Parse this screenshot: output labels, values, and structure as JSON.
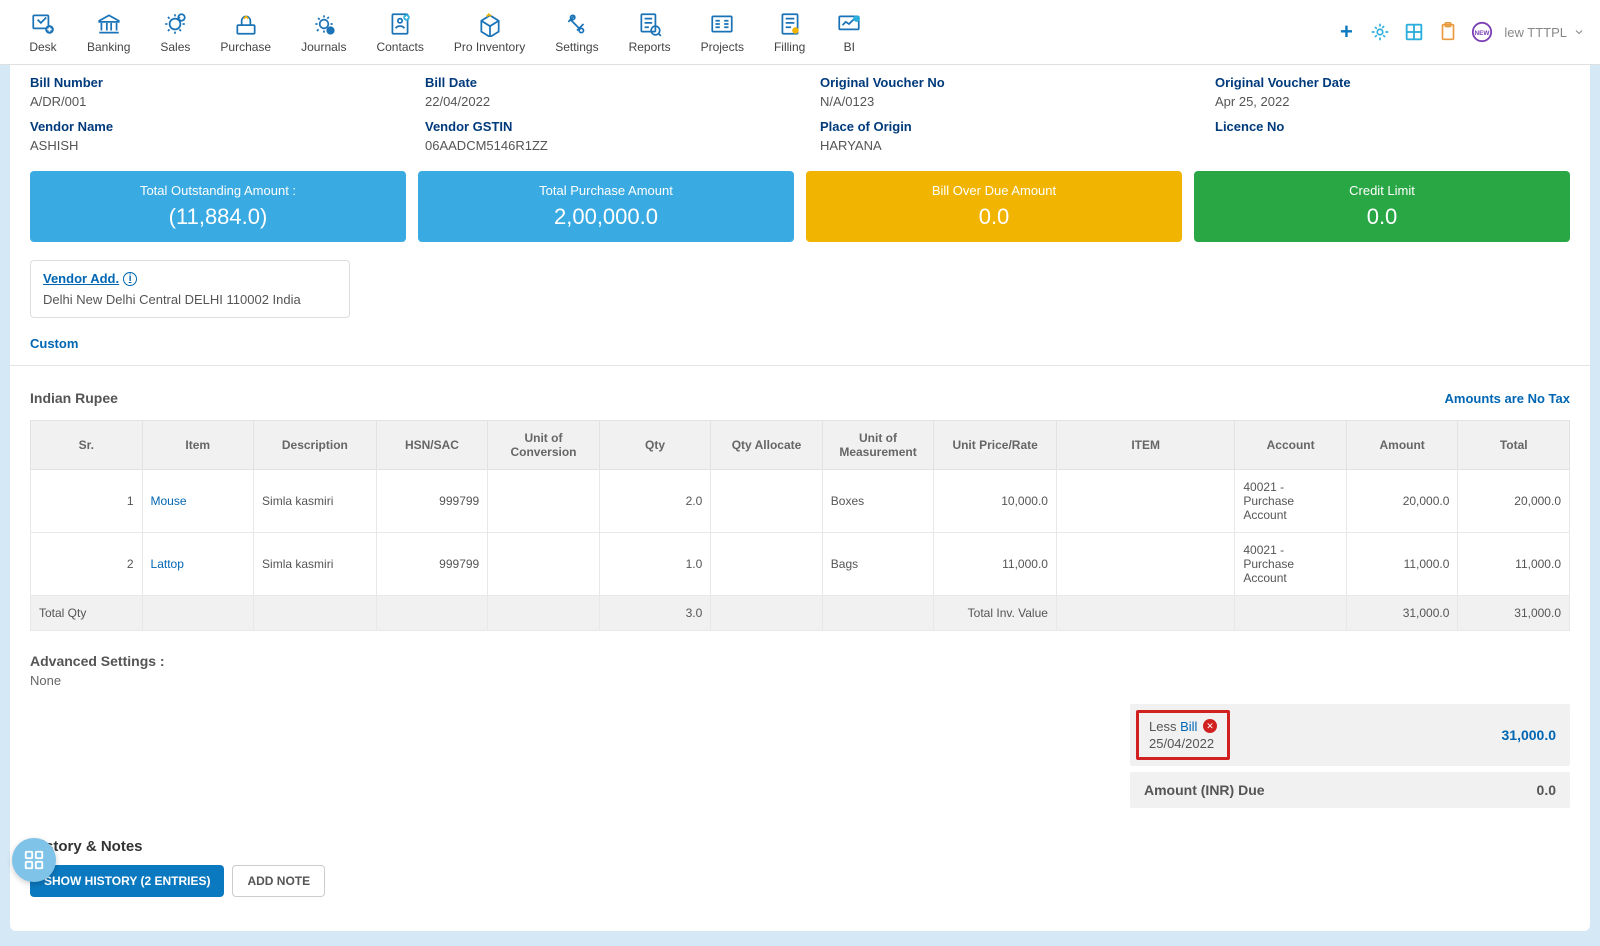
{
  "nav": {
    "items": [
      {
        "label": "Desk"
      },
      {
        "label": "Banking"
      },
      {
        "label": "Sales"
      },
      {
        "label": "Purchase"
      },
      {
        "label": "Journals"
      },
      {
        "label": "Contacts"
      },
      {
        "label": "Pro Inventory"
      },
      {
        "label": "Settings"
      },
      {
        "label": "Reports"
      },
      {
        "label": "Projects"
      },
      {
        "label": "Filling"
      },
      {
        "label": "BI"
      }
    ],
    "user": "lew TTTPL"
  },
  "bill": {
    "bill_number_label": "Bill Number",
    "bill_number": "A/DR/001",
    "bill_date_label": "Bill Date",
    "bill_date": "22/04/2022",
    "orig_voucher_no_label": "Original Voucher No",
    "orig_voucher_no": "N/A/0123",
    "orig_voucher_date_label": "Original Voucher Date",
    "orig_voucher_date": "Apr 25, 2022",
    "vendor_name_label": "Vendor Name",
    "vendor_name": "ASHISH",
    "vendor_gstin_label": "Vendor GSTIN",
    "vendor_gstin": "06AADCM5146R1ZZ",
    "place_of_origin_label": "Place of Origin",
    "place_of_origin": "HARYANA",
    "licence_no_label": "Licence No",
    "licence_no": ""
  },
  "cards": [
    {
      "title": "Total Outstanding Amount :",
      "value": "(11,884.0)",
      "cls": "card-blue"
    },
    {
      "title": "Total Purchase Amount",
      "value": "2,00,000.0",
      "cls": "card-blue2"
    },
    {
      "title": "Bill Over Due Amount",
      "value": "0.0",
      "cls": "card-yellow"
    },
    {
      "title": "Credit Limit",
      "value": "0.0",
      "cls": "card-green"
    }
  ],
  "vendor_addr": {
    "title": "Vendor Add.",
    "text": "Delhi New Delhi Central DELHI 110002 India"
  },
  "custom_label": "Custom",
  "table": {
    "currency": "Indian Rupee",
    "no_tax": "Amounts are No Tax",
    "headers": [
      "Sr.",
      "Item",
      "Description",
      "HSN/SAC",
      "Unit of Conversion",
      "Qty",
      "Qty Allocate",
      "Unit of Measurement",
      "Unit Price/Rate",
      "ITEM",
      "Account",
      "Amount",
      "Total"
    ],
    "rows": [
      {
        "sr": "1",
        "item": "Mouse",
        "desc": "Simla kasmiri",
        "hsn": "999799",
        "uoc": "",
        "qty": "2.0",
        "qtya": "",
        "uom": "Boxes",
        "rate": "10,000.0",
        "itemcol": "",
        "account": "40021 - Purchase Account",
        "amount": "20,000.0",
        "total": "20,000.0"
      },
      {
        "sr": "2",
        "item": "Lattop",
        "desc": "Simla kasmiri",
        "hsn": "999799",
        "uoc": "",
        "qty": "1.0",
        "qtya": "",
        "uom": "Bags",
        "rate": "11,000.0",
        "itemcol": "",
        "account": "40021 - Purchase Account",
        "amount": "11,000.0",
        "total": "11,000.0"
      }
    ],
    "total_row": {
      "label": "Total Qty",
      "qty": "3.0",
      "inv_label": "Total Inv. Value",
      "amount": "31,000.0",
      "total": "31,000.0"
    }
  },
  "advanced": {
    "label": "Advanced Settings :",
    "value": "None"
  },
  "less_bill": {
    "prefix": "Less",
    "link": "Bill",
    "date": "25/04/2022",
    "amount": "31,000.0"
  },
  "due": {
    "label": "Amount (INR) Due",
    "value": "0.0"
  },
  "history": {
    "title": "History & Notes",
    "show_btn": "SHOW HISTORY (2 ENTRIES)",
    "add_btn": "ADD NOTE"
  }
}
